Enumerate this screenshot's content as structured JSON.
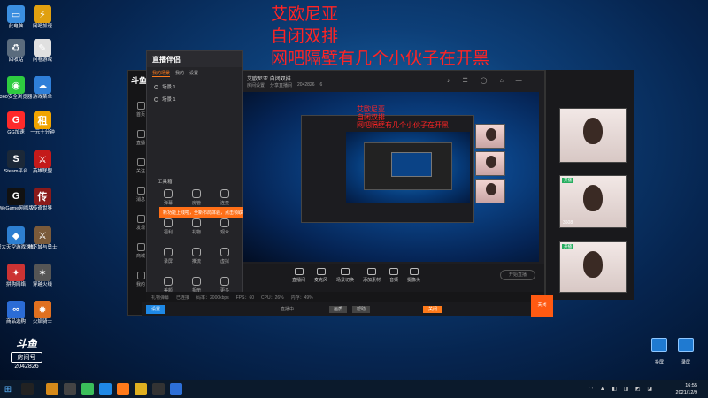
{
  "overlay_text": [
    "艾欧尼亚",
    "自闭双排",
    "网吧隔壁有几个小伙子在开黑"
  ],
  "desktop_icons": [
    {
      "label": "此电脑",
      "color": "#3b8fe0",
      "glyph": "▭"
    },
    {
      "label": "回收站",
      "color": "#5a6b7d",
      "glyph": "♻"
    },
    {
      "label": "360安全浏览器",
      "color": "#2ecc40",
      "glyph": "◉"
    },
    {
      "label": "GG加速",
      "color": "#ff2a2a",
      "glyph": "G"
    },
    {
      "label": "Steam平台",
      "color": "#1b2838",
      "glyph": "S"
    },
    {
      "label": "WeGame网咖版",
      "color": "#111111",
      "glyph": "G"
    },
    {
      "label": "盛大天空游戏对战",
      "color": "#2d7fd1",
      "glyph": "◆"
    },
    {
      "label": "拼购网络",
      "color": "#cc3333",
      "glyph": "✦"
    },
    {
      "label": "商品选购",
      "color": "#2b6cd6",
      "glyph": "∞"
    },
    {
      "label": "网吧加速",
      "color": "#e0a010",
      "glyph": "⚡"
    },
    {
      "label": "问卷游戏",
      "color": "#e0e0e0",
      "glyph": "✎"
    },
    {
      "label": "游戏菜单",
      "color": "#2f7fd8",
      "glyph": "☁"
    },
    {
      "label": "一元十分钟",
      "color": "#f1a400",
      "glyph": "租"
    },
    {
      "label": "英雄联盟",
      "color": "#c41a1a",
      "glyph": "⚔"
    },
    {
      "label": "传奇世界",
      "color": "#8b1a1a",
      "glyph": "传"
    },
    {
      "label": "地下城与勇士",
      "color": "#7a5a3a",
      "glyph": "⚔"
    },
    {
      "label": "穿越火线",
      "color": "#555555",
      "glyph": "✶"
    },
    {
      "label": "火焰骑士",
      "color": "#e07020",
      "glyph": "✹"
    }
  ],
  "douyu": {
    "logo": "斗鱼",
    "room_label": "房间号",
    "room_id": "2042826"
  },
  "studio": {
    "brand": "直播伴侣",
    "tabs": [
      "我的场景",
      "我的",
      "设置"
    ],
    "scenes": [
      "场景 1",
      "场景 1"
    ],
    "toolbox_title": "工具箱",
    "tools": [
      "弹幕",
      "房管",
      "连麦",
      "福利",
      "礼物",
      "观众",
      "录屏",
      "推流",
      "虚拟",
      "美颜",
      "相册",
      "更多"
    ],
    "banner": "新功能上线啦，全新布局体验，点击领取新礼包",
    "preview_title": "艾欧尼亚 自闭双排",
    "preview_room": "2042826",
    "preview_meta": [
      "房间设置",
      "分享直播间",
      "2042826",
      "6"
    ],
    "toolbar": [
      "直播间",
      "麦克风",
      "场景切换",
      "添加素材",
      "音频",
      "摄像头"
    ],
    "start_live": "开始直播",
    "status": [
      "礼物弹幕",
      "已连接",
      "码率：2000kbps",
      "FPS：60",
      "CPU：26%",
      "内存：49%"
    ],
    "footer_btn": "设置",
    "footer_text": "直播中",
    "footer_pills": [
      "画质",
      "帮助",
      "关闭"
    ],
    "side_nav": [
      "首页",
      "直播",
      "关注",
      "消息",
      "发现",
      "商城",
      "我的"
    ]
  },
  "cams": [
    {
      "badge": "",
      "num": ""
    },
    {
      "badge": "开播",
      "num": "3608"
    },
    {
      "badge": "开播",
      "num": ""
    }
  ],
  "taskbar": {
    "time": "16:55",
    "date": "2021/12/9"
  },
  "br_icons": [
    "投屏",
    "录屏"
  ]
}
